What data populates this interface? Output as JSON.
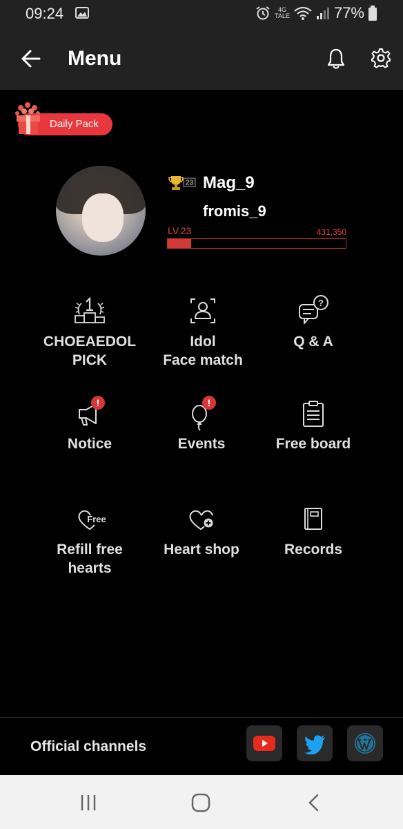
{
  "status_bar": {
    "time": "09:24",
    "network_top": "4G",
    "network_bottom": "TALE",
    "battery": "77%"
  },
  "app_bar": {
    "title": "Menu"
  },
  "daily_pack": {
    "label": "Daily Pack"
  },
  "profile": {
    "trophy_count": "23",
    "username": "Mag_9",
    "group": "fromis_9",
    "level": "LV.23",
    "points": "431,350",
    "level_progress": 0.13
  },
  "menu": {
    "choeaedol_pick": {
      "line1": "CHOEAEDOL",
      "line2": "PICK"
    },
    "face_match": {
      "line1": "Idol",
      "line2": "Face match"
    },
    "qa": {
      "label": "Q & A"
    },
    "notice": {
      "label": "Notice",
      "badge": "!"
    },
    "events": {
      "label": "Events",
      "badge": "!"
    },
    "free_board": {
      "label": "Free board"
    },
    "refill": {
      "line1": "Refill free",
      "line2": "hearts",
      "icon_text": "Free"
    },
    "heart_shop": {
      "label": "Heart shop"
    },
    "records": {
      "label": "Records"
    }
  },
  "footer": {
    "channels_label": "Official channels"
  },
  "colors": {
    "accent": "#e3403c",
    "youtube": "#e62b1e",
    "twitter": "#1da1f2",
    "wordpress": "#21759b"
  }
}
